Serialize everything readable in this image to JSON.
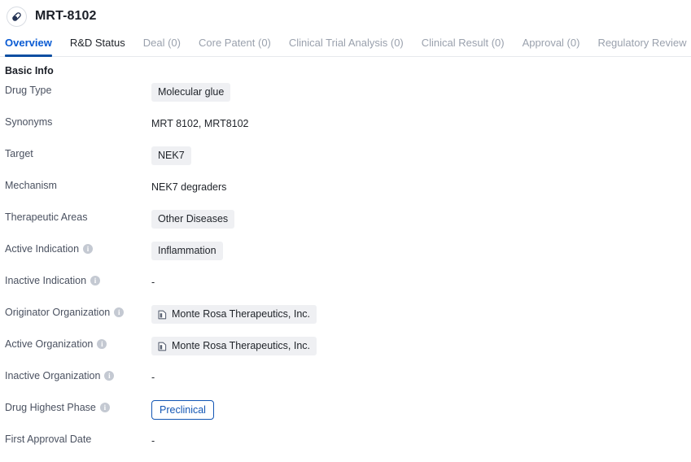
{
  "header": {
    "icon": "pill-capsule-icon",
    "title": "MRT-8102"
  },
  "tabs": [
    {
      "label": "Overview",
      "state": "active"
    },
    {
      "label": "R&D Status",
      "state": "dark"
    },
    {
      "label": "Deal (0)",
      "state": "muted"
    },
    {
      "label": "Core Patent (0)",
      "state": "muted"
    },
    {
      "label": "Clinical Trial Analysis (0)",
      "state": "muted"
    },
    {
      "label": "Clinical Result (0)",
      "state": "muted"
    },
    {
      "label": "Approval (0)",
      "state": "muted"
    },
    {
      "label": "Regulatory Review",
      "state": "muted"
    }
  ],
  "basic_info": {
    "section_title": "Basic Info",
    "rows": [
      {
        "label": "Drug Type",
        "info": false,
        "type": "tag",
        "value": "Molecular glue"
      },
      {
        "label": "Synonyms",
        "info": false,
        "type": "text",
        "value": "MRT 8102,  MRT8102"
      },
      {
        "label": "Target",
        "info": false,
        "type": "tag",
        "value": "NEK7"
      },
      {
        "label": "Mechanism",
        "info": false,
        "type": "text",
        "value": "NEK7 degraders"
      },
      {
        "label": "Therapeutic Areas",
        "info": false,
        "type": "tag",
        "value": "Other Diseases"
      },
      {
        "label": "Active Indication",
        "info": true,
        "type": "tag",
        "value": "Inflammation"
      },
      {
        "label": "Inactive Indication",
        "info": true,
        "type": "text",
        "value": "-"
      },
      {
        "label": "Originator Organization",
        "info": true,
        "type": "org-tag",
        "value": "Monte Rosa Therapeutics, Inc."
      },
      {
        "label": "Active Organization",
        "info": true,
        "type": "org-tag",
        "value": "Monte Rosa Therapeutics, Inc."
      },
      {
        "label": "Inactive Organization",
        "info": true,
        "type": "text",
        "value": "-"
      },
      {
        "label": "Drug Highest Phase",
        "info": true,
        "type": "button",
        "value": "Preclinical"
      },
      {
        "label": "First Approval Date",
        "info": false,
        "type": "text",
        "value": "-"
      }
    ]
  },
  "colors": {
    "accent_blue": "#0a5bd3",
    "tab_underline": "#0b4ea2",
    "tag_background": "#eff0f3",
    "muted_text": "#9aa1ad",
    "phase_border": "#1356b4"
  },
  "icons": {
    "info": "i",
    "org": "organization-doc-icon"
  }
}
